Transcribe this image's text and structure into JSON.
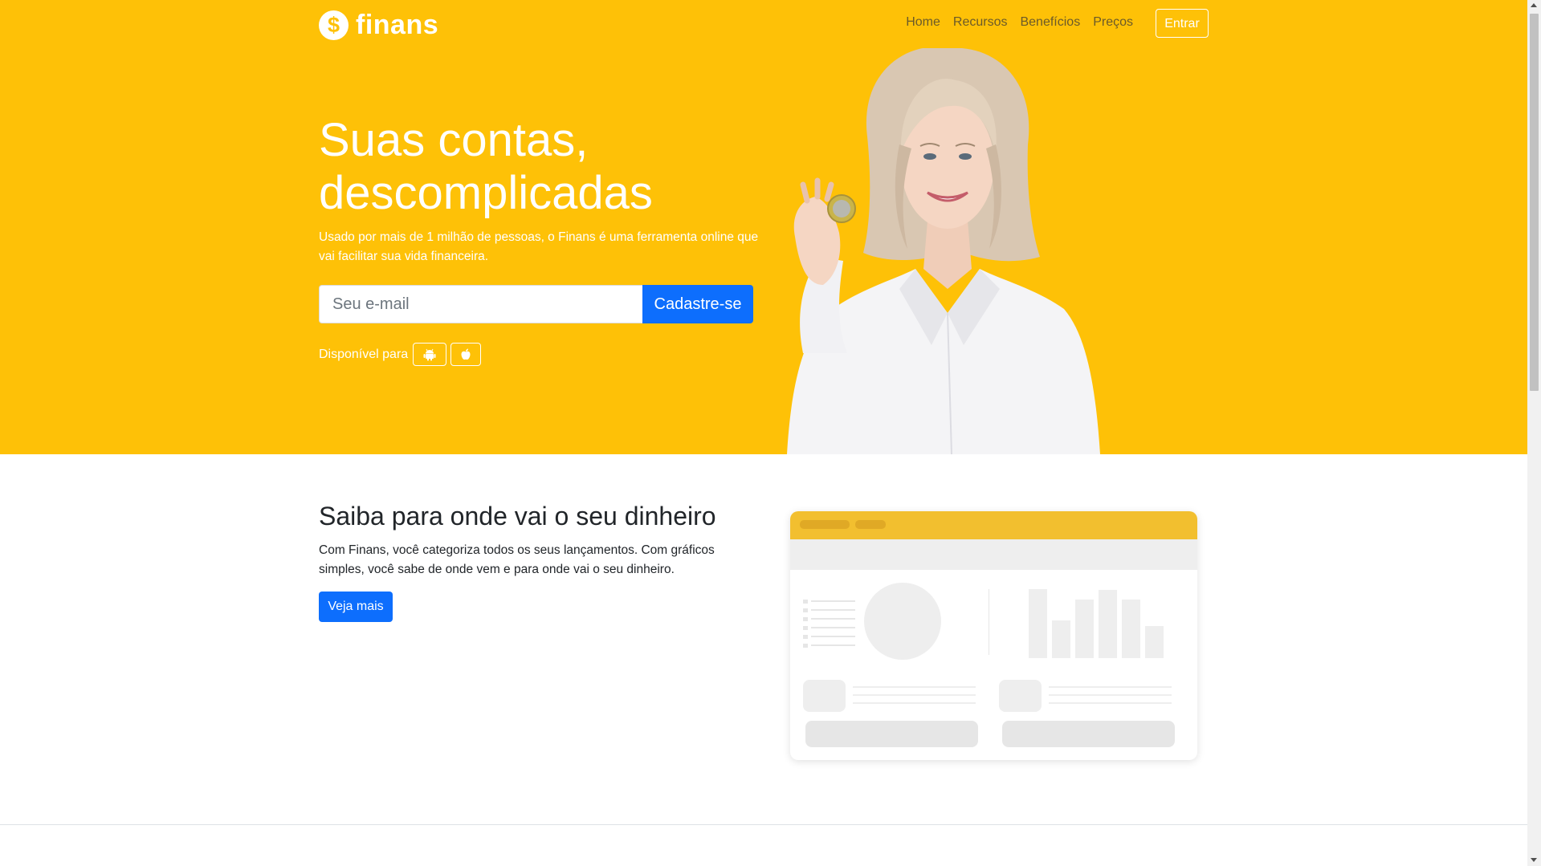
{
  "brand": {
    "name": "finans",
    "logo_icon": "dollar-coin-icon"
  },
  "nav": {
    "items": [
      "Home",
      "Recursos",
      "Benefícios",
      "Preços"
    ],
    "login_label": "Entrar"
  },
  "hero": {
    "title_line1": "Suas contas,",
    "title_line2": "descomplicadas",
    "subtitle": "Usado por mais de 1 milhão de pessoas, o Finans é uma ferramenta online que vai facilitar sua vida financeira.",
    "email_placeholder": "Seu e-mail",
    "signup_label": "Cadastre-se",
    "available_label": "Disponível para",
    "stores": [
      "android-icon",
      "apple-icon"
    ]
  },
  "feature": {
    "title": "Saiba para onde vai o seu dinheiro",
    "text": "Com Finans, você categoriza todos os seus lançamentos. Com gráficos simples, você sabe de onde vem e para onde vai o seu dinheiro.",
    "button_label": "Veja mais"
  },
  "colors": {
    "primary_yellow": "#fec107",
    "primary_blue": "#0d6efd",
    "mock_header": "#f2bf2f"
  }
}
